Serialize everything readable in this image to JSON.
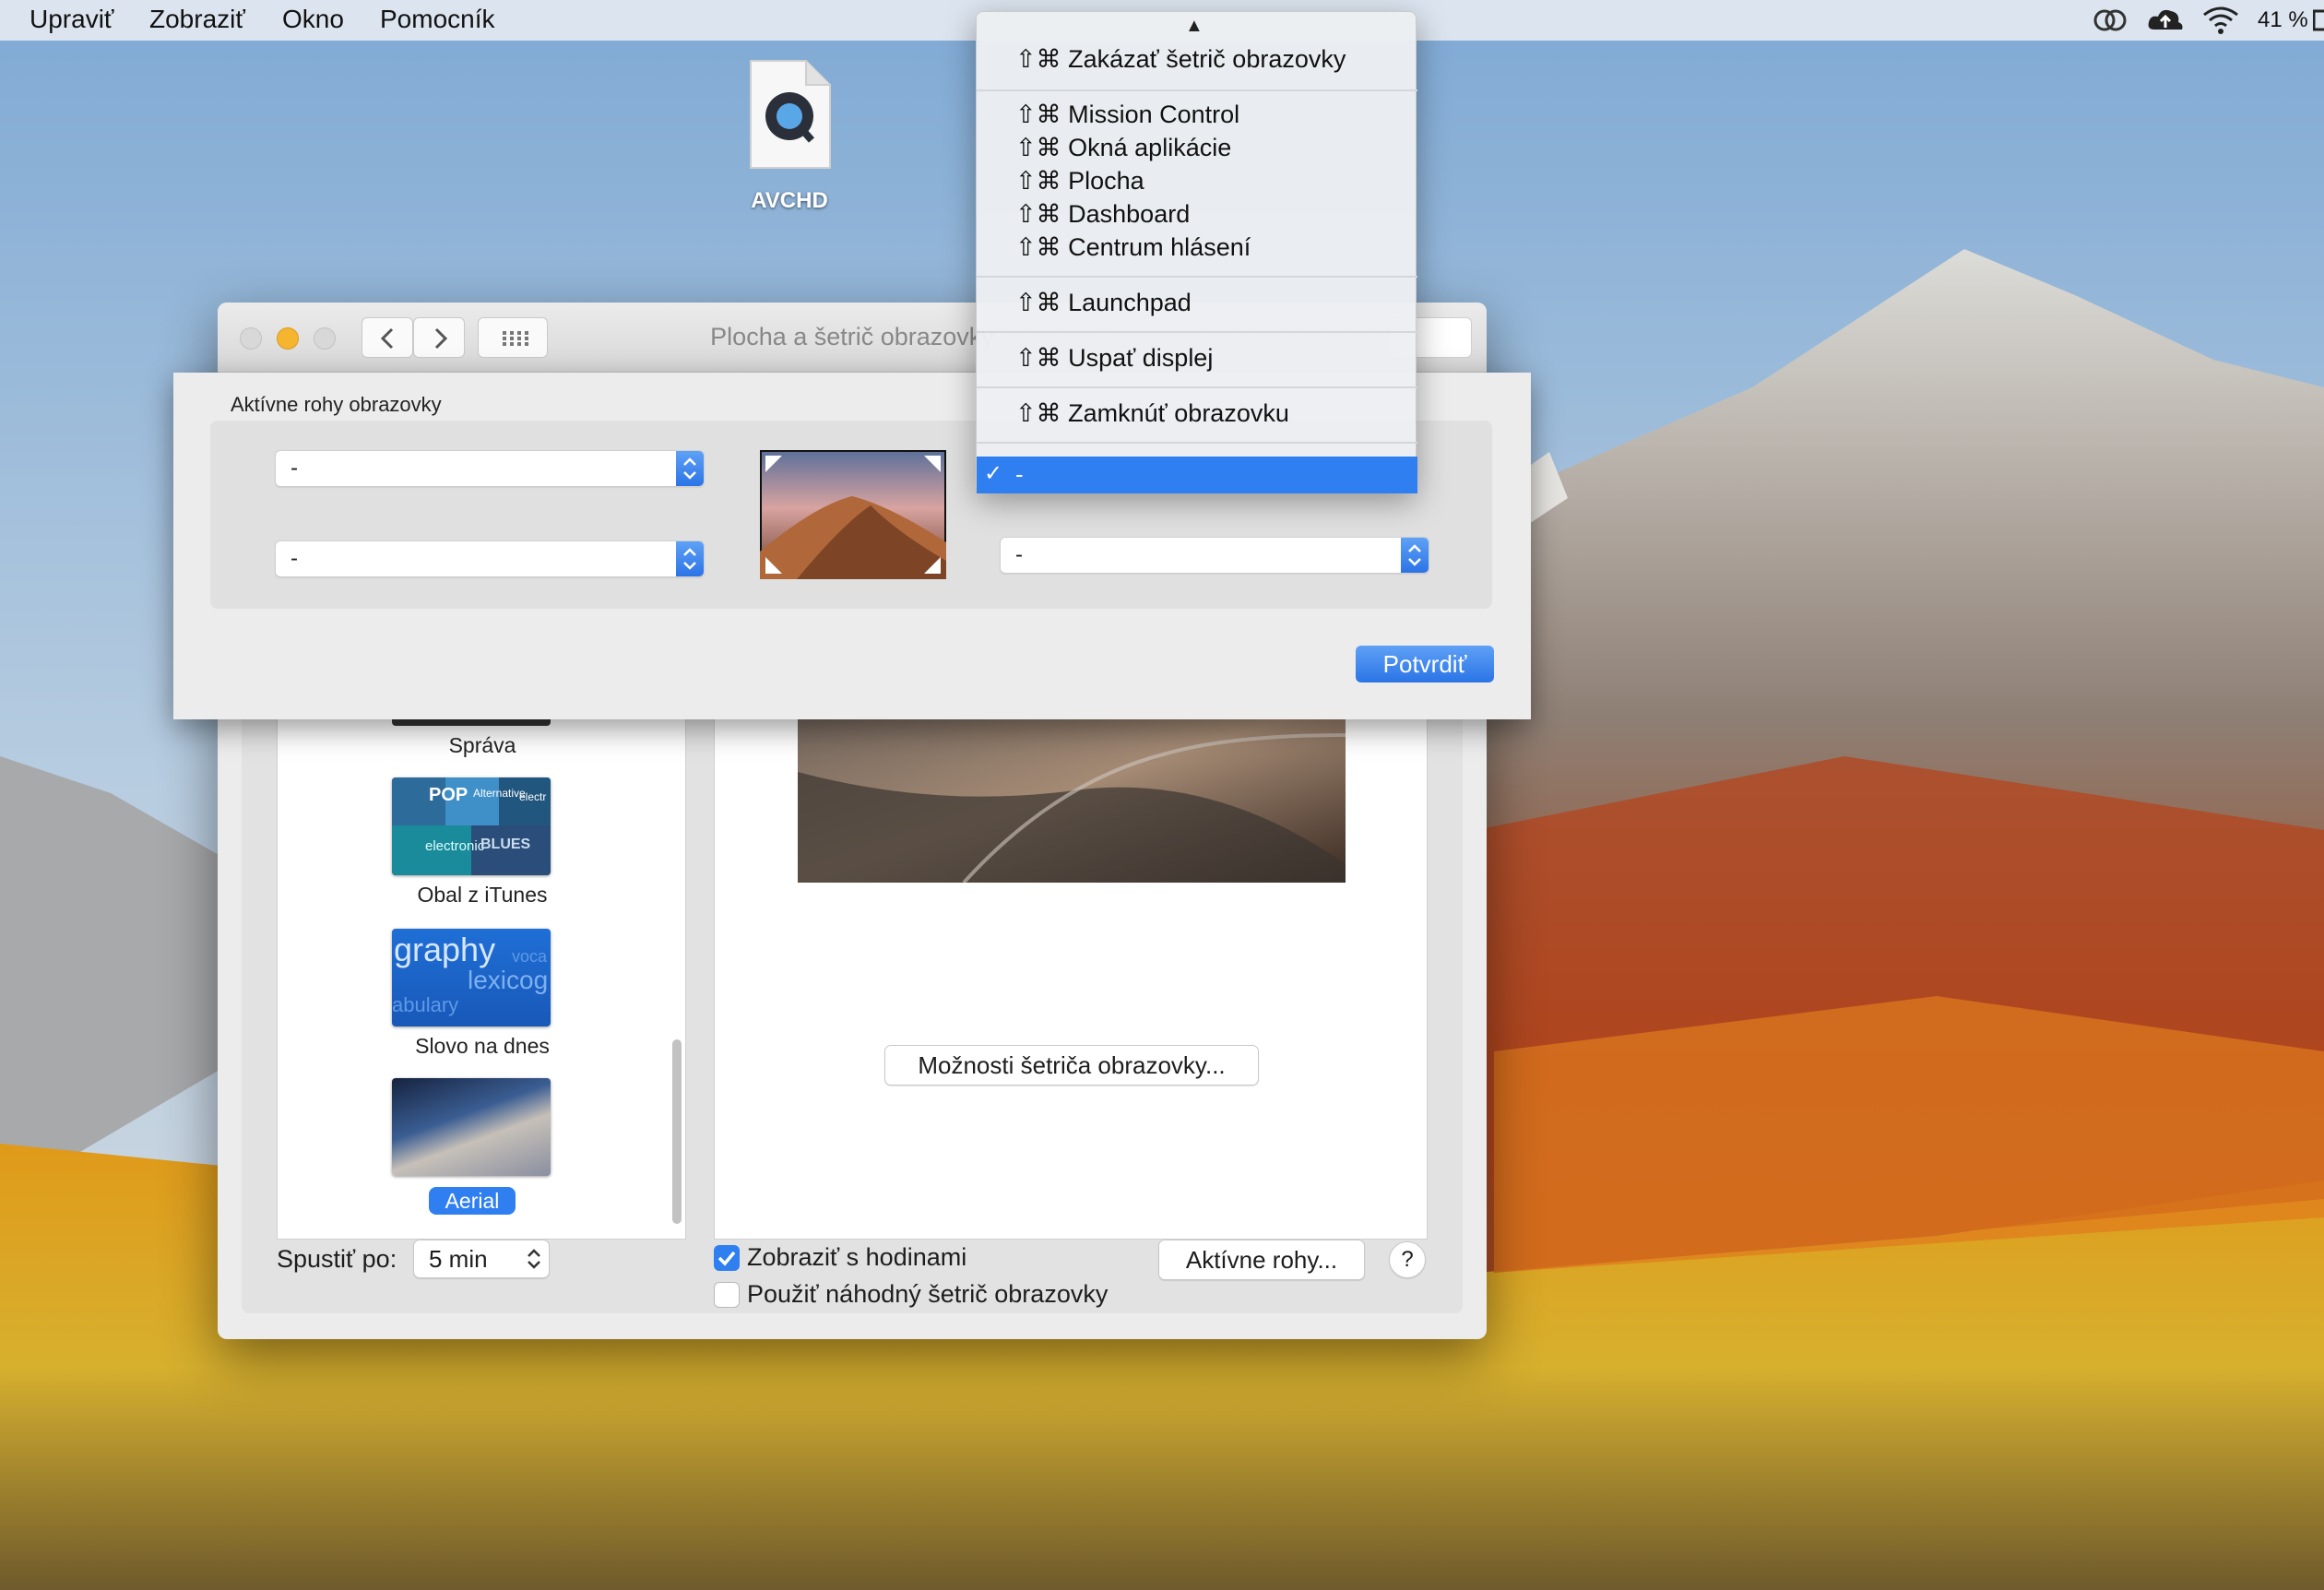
{
  "menubar": {
    "items": [
      "Upraviť",
      "Zobraziť",
      "Okno",
      "Pomocník"
    ],
    "battery": "41 %"
  },
  "desktop": {
    "file_label": "AVCHD"
  },
  "window": {
    "title": "Plocha a šetrič obrazovky",
    "savers": [
      {
        "label": "Správa"
      },
      {
        "label": "Obal z iTunes"
      },
      {
        "label": "Slovo na dnes"
      },
      {
        "label": "Aerial"
      }
    ],
    "options_button": "Možnosti šetriča obrazovky...",
    "start_after_label": "Spustiť po:",
    "start_after_value": "5 min",
    "show_clock_label": "Zobraziť s hodinami",
    "random_label": "Použiť náhodný šetrič obrazovky",
    "hot_corners_button": "Aktívne rohy...",
    "help_button": "?",
    "thumb_text": {
      "itunes": [
        "POP",
        "Alternative",
        "electr",
        "electronic",
        "BLUES"
      ],
      "word": [
        "graphy",
        "voca",
        "lexicog",
        "abulary"
      ]
    }
  },
  "sheet": {
    "title": "Aktívne rohy obrazovky",
    "corner_top_left": "-",
    "corner_bottom_left": "-",
    "corner_top_right": "-",
    "corner_bottom_right": "-",
    "confirm_button": "Potvrdiť"
  },
  "dropdown": {
    "up_arrow": "▲",
    "items": [
      "⇧⌘ Zakázať šetrič obrazovky",
      "⇧⌘ Mission Control",
      "⇧⌘ Okná aplikácie",
      "⇧⌘ Plocha",
      "⇧⌘ Dashboard",
      "⇧⌘ Centrum hlásení",
      "⇧⌘ Launchpad",
      "⇧⌘ Uspať displej",
      "⇧⌘ Zamknúť obrazovku"
    ],
    "selected": "-",
    "check": "✓"
  },
  "colors": {
    "accent": "#2f7ff0",
    "traffic_red": "#d8d8d8",
    "traffic_yellow": "#f5b52f"
  }
}
